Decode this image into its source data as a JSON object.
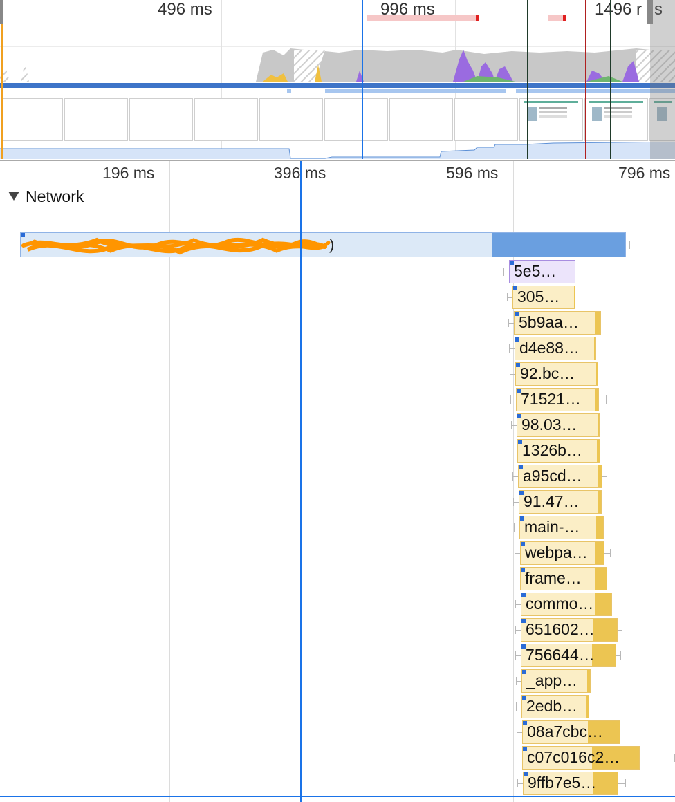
{
  "overview": {
    "ticks": [
      "496 ms",
      "996 ms",
      "1496 r",
      "s"
    ]
  },
  "flame": {
    "ticks": [
      "196 ms",
      "396 ms",
      "596 ms",
      "796 ms"
    ],
    "track_label": "Network",
    "main_request_label": "(redacted)",
    "main_request_suffix": ")",
    "requests": [
      "5e5…",
      "305…",
      "5b9aa…",
      "d4e88…",
      "92.bc…",
      "71521…",
      "98.03…",
      "1326b…",
      "a95cd…",
      "91.47…",
      "main-…",
      "webpa…",
      "frame…",
      "commo…",
      "651602…",
      "756644…",
      "_app…",
      "2edb…",
      "08a7cbc…",
      "c07c016c2…",
      "9ffb7e5…"
    ]
  },
  "colors": {
    "accent_blue": "#1a73e8",
    "js_request": "#f5d98c",
    "js_request_light": "#fbeec6",
    "font_request": "#d9c8f4",
    "document_request": "#dce9f7",
    "document_receive": "#6a9fe0",
    "redaction_scribble": "#ff9500"
  },
  "icons": [
    "expand-triangle-icon"
  ]
}
